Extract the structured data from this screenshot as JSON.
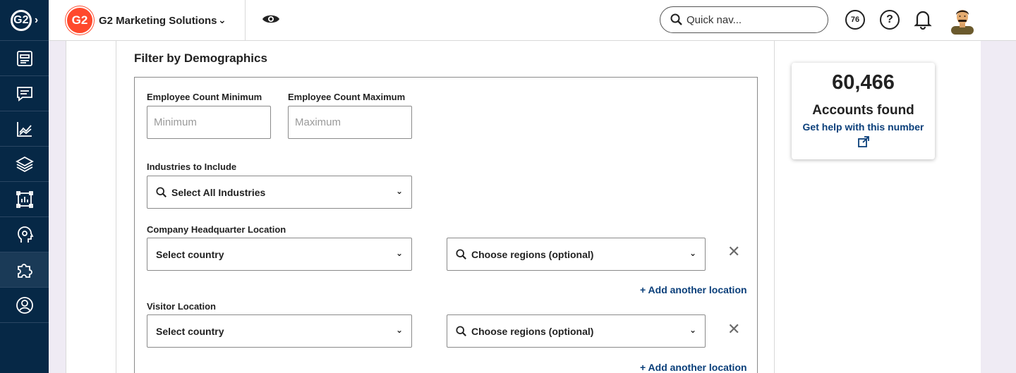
{
  "sidebar": {
    "logo": "G2",
    "items": [
      {
        "icon": "dashboard-icon"
      },
      {
        "icon": "chat-icon"
      },
      {
        "icon": "chart-icon"
      },
      {
        "icon": "layers-icon"
      },
      {
        "icon": "report-icon"
      },
      {
        "icon": "head-icon"
      },
      {
        "icon": "puzzle-icon",
        "active": true
      },
      {
        "icon": "user-circle-icon"
      }
    ]
  },
  "topbar": {
    "brand_logo": "G2",
    "brand_name": "G2 Marketing Solutions",
    "brand_chevron": "⌄",
    "quick_nav_placeholder": "Quick nav...",
    "score_badge": "76",
    "help": "?"
  },
  "filter": {
    "title": "Filter by Demographics",
    "employee_min_label": "Employee Count Minimum",
    "employee_min_placeholder": "Minimum",
    "employee_max_label": "Employee Count Maximum",
    "employee_max_placeholder": "Maximum",
    "industries_label": "Industries to Include",
    "industries_select": "Select All Industries",
    "hq_label": "Company Headquarter Location",
    "hq_country": "Select country",
    "hq_regions": "Choose regions (optional)",
    "hq_add": "+ Add another location",
    "visitor_label": "Visitor Location",
    "visitor_country": "Select country",
    "visitor_regions": "Choose regions (optional)",
    "visitor_add": "+ Add another location",
    "remove_symbol": "✕",
    "caret": "⌄"
  },
  "results": {
    "count": "60,466",
    "label": "Accounts found",
    "help_link": "Get help with this number"
  },
  "colors": {
    "sidebar": "#062846",
    "brand": "#ff492c",
    "link": "#0a3f7a",
    "page_bg": "#efebf4"
  }
}
